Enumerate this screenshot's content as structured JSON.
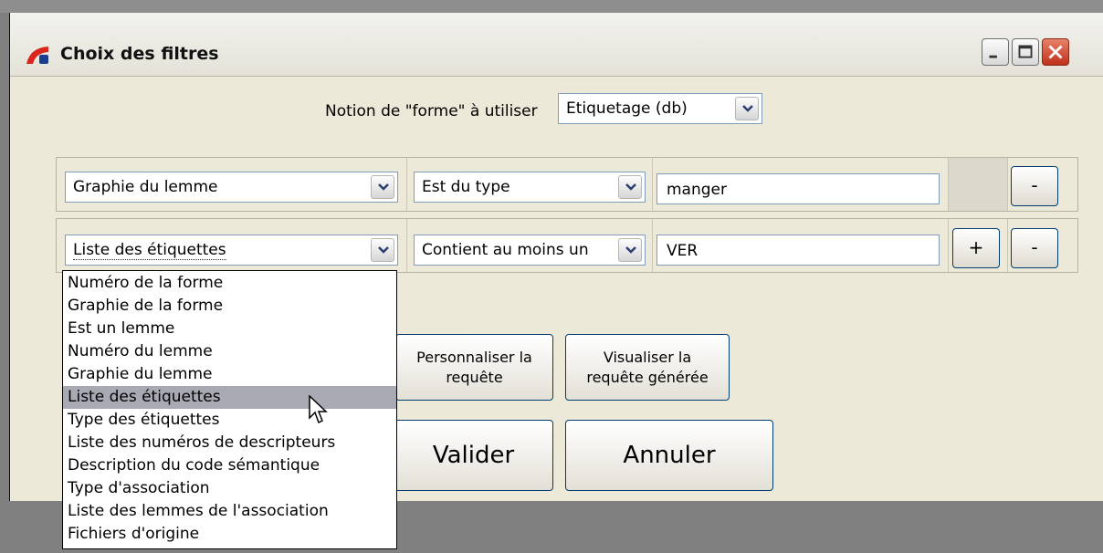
{
  "window": {
    "title": "Choix des filtres",
    "icon": "app-logo-icon"
  },
  "notion": {
    "label": "Notion de \"forme\" à utiliser",
    "selected": "Etiquetage (db)"
  },
  "filters": [
    {
      "field": "Graphie du lemme",
      "operator": "Est du type",
      "value": "manger",
      "remove_label": "-"
    },
    {
      "field": "Liste des étiquettes",
      "operator": "Contient au moins un",
      "value": "VER",
      "add_label": "+",
      "remove_label": "-"
    }
  ],
  "dropdown": {
    "options": [
      "Numéro de la forme",
      "Graphie de la forme",
      "Est un lemme",
      "Numéro du lemme",
      "Graphie du lemme",
      "Liste des étiquettes",
      "Type des étiquettes",
      "Liste des numéros de descripteurs",
      "Description du code sémantique",
      "Type d'association",
      "Liste des lemmes de l'association",
      "Fichiers d'origine"
    ],
    "highlighted": "Liste des étiquettes"
  },
  "buttons": {
    "personnaliser": "Personnaliser la requête",
    "visualiser": "Visualiser la requête générée",
    "valider": "Valider",
    "annuler": "Annuler"
  },
  "colors": {
    "highlight": "#a9a9b3",
    "window_bg": "#ece9d8",
    "close_button": "#c0301a"
  }
}
